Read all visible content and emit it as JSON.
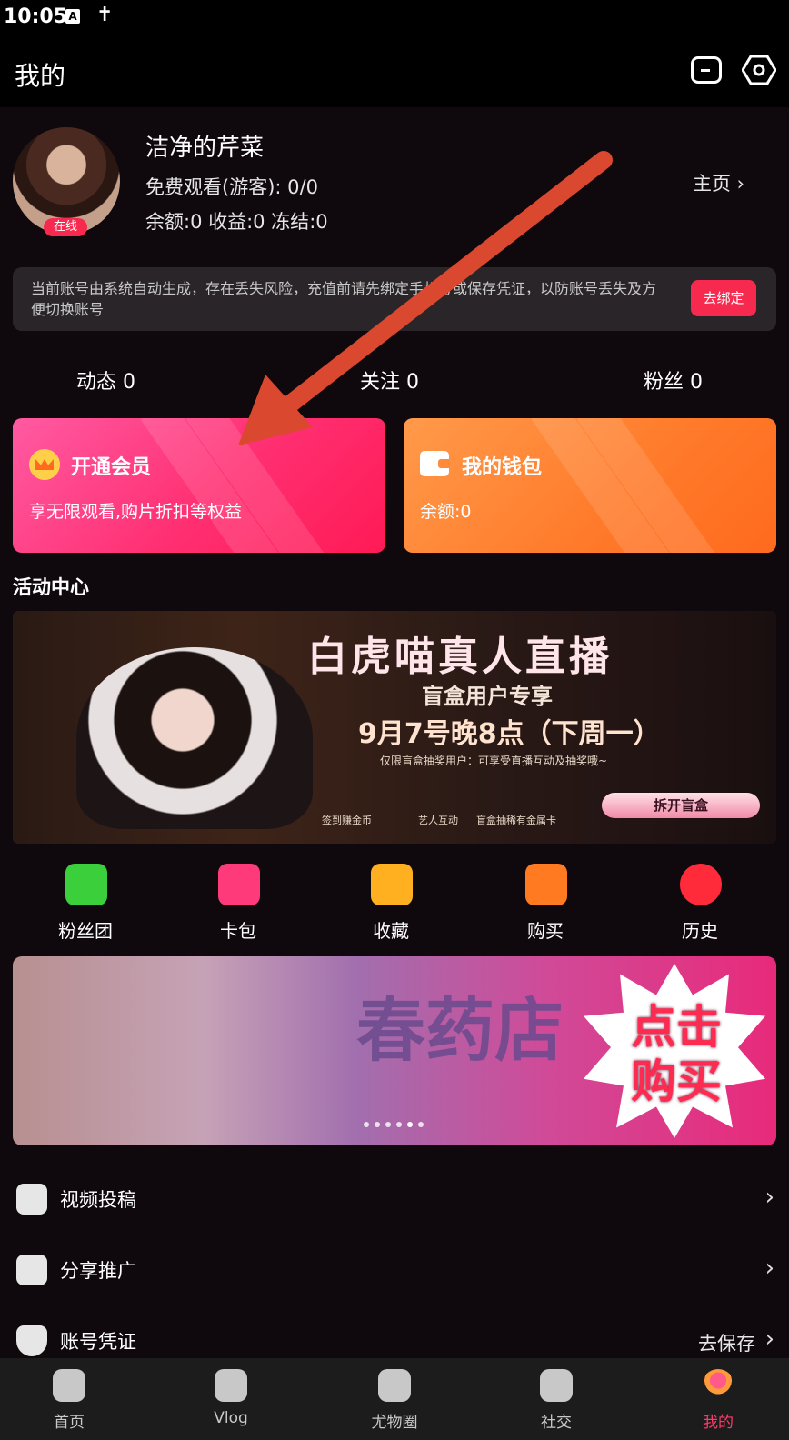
{
  "status_bar": {
    "time": "10:05",
    "a_glyph": "A",
    "accessibility_glyph": "✝"
  },
  "header": {
    "title": "我的"
  },
  "profile": {
    "username": "洁净的芹菜",
    "free_watch": "免费观看(游客): 0/0",
    "balance_line": "余额:0 收益:0 冻结:0",
    "online_badge": "在线",
    "homepage_link": "主页 ›"
  },
  "notice": {
    "text": "当前账号由系统自动生成，存在丢失风险，充值前请先绑定手机号或保存凭证，以防账号丢失及方便切换账号",
    "button": "去绑定"
  },
  "stats": [
    {
      "label": "动态 0"
    },
    {
      "label": "关注 0"
    },
    {
      "label": "粉丝 0"
    }
  ],
  "vip_card": {
    "title": "开通会员",
    "subtitle": "享无限观看,购片折扣等权益"
  },
  "wallet_card": {
    "title": "我的钱包",
    "subtitle": "余额:0"
  },
  "activity": {
    "title": "活动中心",
    "live_banner": {
      "title": "白虎喵真人直播",
      "subtitle": "盲盒用户专享",
      "date": "9月7号晚8点（下周一）",
      "note": "仅限盲盒抽奖用户：可享受直播互动及抽奖哦~",
      "features": [
        "签到赚金币",
        "艺人互动",
        "盲盒抽稀有金属卡"
      ],
      "button": "拆开盲盒"
    }
  },
  "quick_icons": [
    {
      "label": "粉丝团",
      "color": "#3ccf3c"
    },
    {
      "label": "卡包",
      "color": "#ff3a7a"
    },
    {
      "label": "收藏",
      "color": "#ffb020"
    },
    {
      "label": "购买",
      "color": "#ff7a20"
    },
    {
      "label": "历史",
      "color": "#ff2a3a"
    }
  ],
  "shop_banner": {
    "title": "春药店",
    "cta": "点击购买"
  },
  "menu": [
    {
      "label": "视频投稿"
    },
    {
      "label": "分享推广"
    },
    {
      "label": "账号凭证",
      "action": "去保存"
    }
  ],
  "bottom_nav": [
    {
      "label": "首页"
    },
    {
      "label": "Vlog"
    },
    {
      "label": "尤物圈"
    },
    {
      "label": "社交"
    },
    {
      "label": "我的",
      "active": true
    }
  ],
  "colors": {
    "accent": "#f7294f",
    "annotation_arrow": "#d9482f"
  }
}
